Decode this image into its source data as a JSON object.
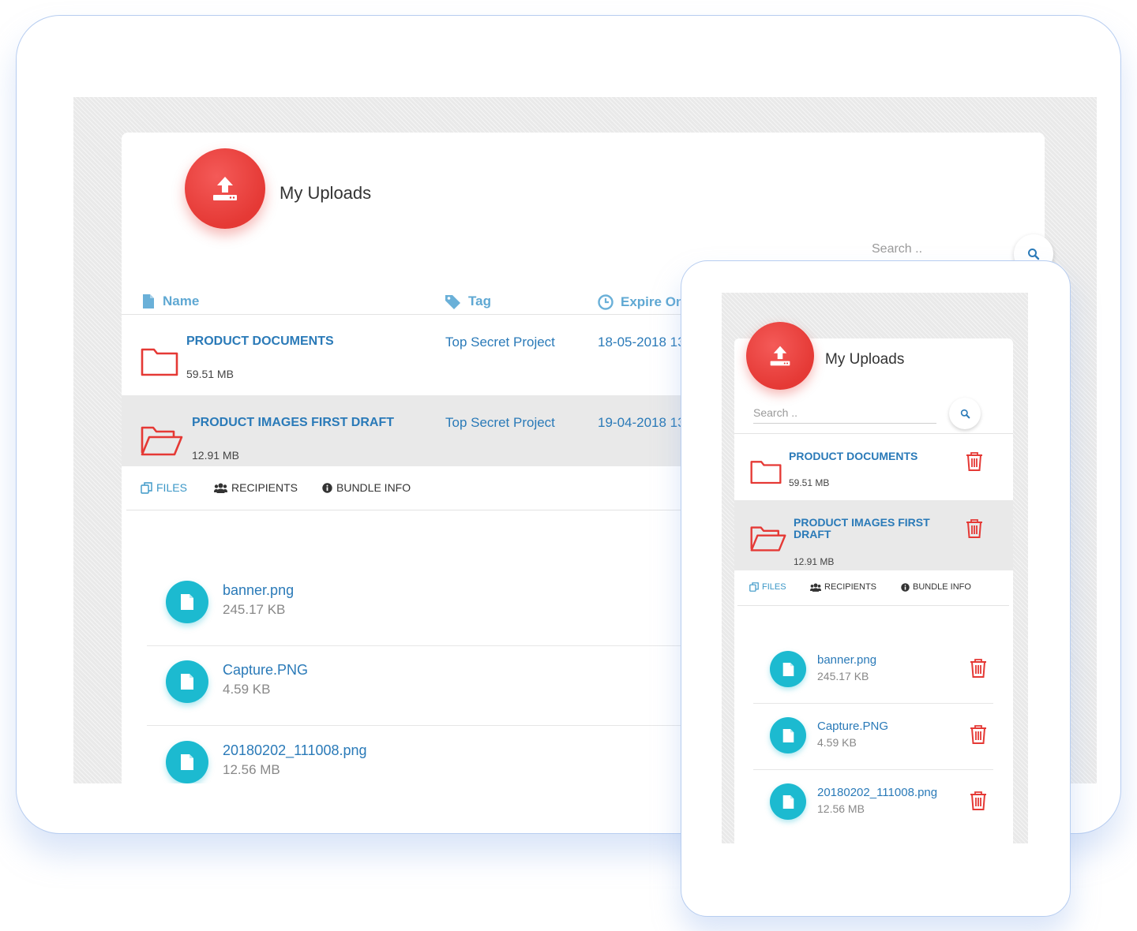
{
  "tablet": {
    "title": "My Uploads",
    "search_placeholder": "Search ..",
    "columns": {
      "name": "Name",
      "tag": "Tag",
      "expire": "Expire On"
    },
    "bundles": [
      {
        "name": "PRODUCT DOCUMENTS",
        "size": "59.51 MB",
        "tag": "Top Secret Project",
        "expire": "18-05-2018 13:0"
      },
      {
        "name": "PRODUCT IMAGES FIRST DRAFT",
        "size": "12.91 MB",
        "tag": "Top Secret Project",
        "expire": "19-04-2018 13:0"
      }
    ],
    "tabs": {
      "files": "FILES",
      "recipients": "RECIPIENTS",
      "bundle_info": "BUNDLE INFO"
    },
    "files": [
      {
        "name": "banner.png",
        "size": "245.17 KB"
      },
      {
        "name": "Capture.PNG",
        "size": "4.59 KB"
      },
      {
        "name": "20180202_111008.png",
        "size": "12.56 MB"
      }
    ]
  },
  "phone": {
    "title": "My Uploads",
    "search_placeholder": "Search ..",
    "bundles": [
      {
        "name": "PRODUCT DOCUMENTS",
        "size": "59.51 MB"
      },
      {
        "name_line1": "PRODUCT IMAGES FIRST",
        "name_line2": "DRAFT",
        "size": "12.91 MB"
      }
    ],
    "tabs": {
      "files": "FILES",
      "recipients": "RECIPIENTS",
      "bundle_info": "BUNDLE INFO"
    },
    "files": [
      {
        "name": "banner.png",
        "size": "245.17 KB"
      },
      {
        "name": "Capture.PNG",
        "size": "4.59 KB"
      },
      {
        "name": "20180202_111008.png",
        "size": "12.56 MB"
      }
    ]
  },
  "colors": {
    "accent_red": "#e53935",
    "link_blue": "#2a7ab8",
    "header_blue": "#5fa8d3",
    "file_teal": "#1cbad0"
  },
  "icons": [
    "upload-icon",
    "search-icon",
    "file-icon",
    "tag-icon",
    "clock-icon",
    "lock-icon",
    "user-icon",
    "folder-icon",
    "folder-open-icon",
    "copy-icon",
    "users-icon",
    "info-icon",
    "trash-icon"
  ]
}
